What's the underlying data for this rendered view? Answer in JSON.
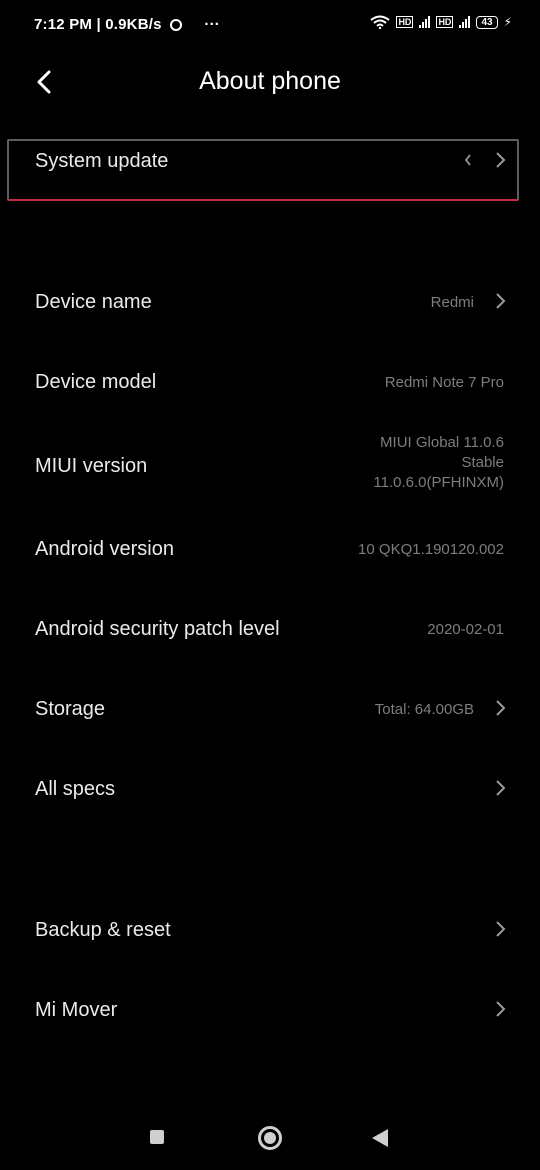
{
  "status_bar": {
    "time_speed": "7:12 PM | 0.9KB/s",
    "more": "···",
    "net_tag_1": "HD",
    "net_tag_2": "HD",
    "battery": "43"
  },
  "header": {
    "title": "About phone"
  },
  "items": [
    {
      "label": "System update",
      "value": "",
      "chevron": true
    },
    {
      "label": "Device name",
      "value": "Redmi",
      "chevron": true
    },
    {
      "label": "Device model",
      "value": "Redmi Note 7 Pro",
      "chevron": false
    },
    {
      "label": "MIUI version",
      "value_lines": [
        "MIUI Global 11.0.6",
        "Stable",
        "11.0.6.0(PFHINXM)"
      ],
      "chevron": false
    },
    {
      "label": "Android version",
      "value": "10 QKQ1.190120.002",
      "chevron": false
    },
    {
      "label": "Android security patch level",
      "value": "2020-02-01",
      "chevron": false
    },
    {
      "label": "Storage",
      "value": "Total: 64.00GB",
      "chevron": true
    },
    {
      "label": "All specs",
      "value": "",
      "chevron": true
    },
    {
      "label": "Backup & reset",
      "value": "",
      "chevron": true
    },
    {
      "label": "Mi Mover",
      "value": "",
      "chevron": true
    }
  ],
  "colors": {
    "background": "#000000",
    "focus_bottom": "#c62b3f",
    "value_text": "#7d7d7d"
  }
}
